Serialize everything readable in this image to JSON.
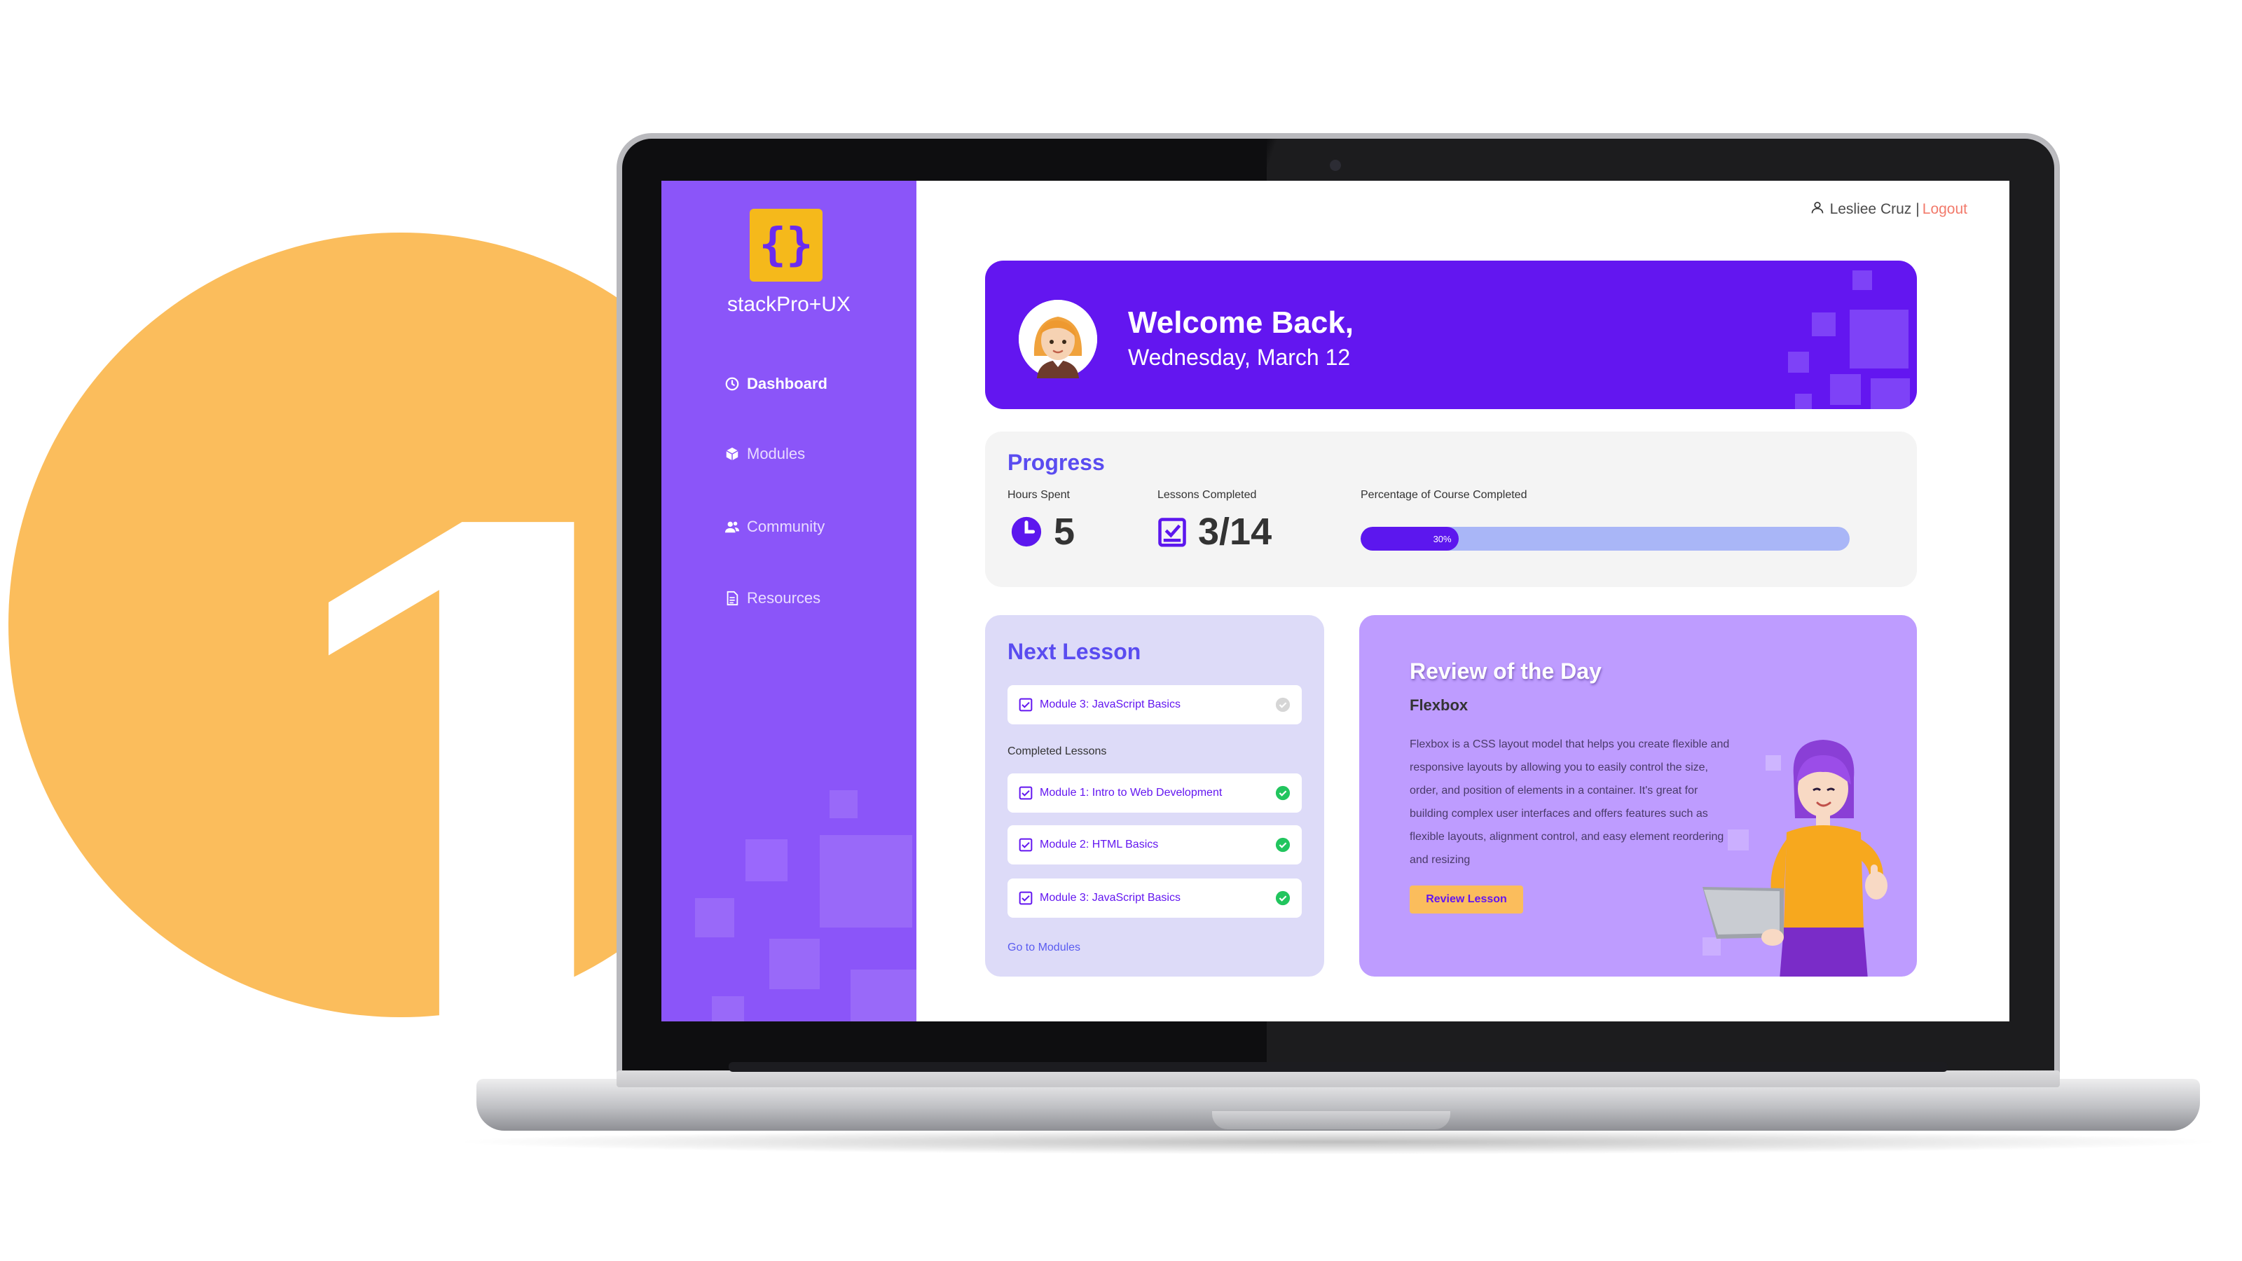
{
  "badge": {
    "numeral": "1"
  },
  "sidebar": {
    "brand": "stackPro+UX",
    "logo_glyph": "{}",
    "items": [
      {
        "label": "Dashboard",
        "icon": "clock-icon",
        "active": true
      },
      {
        "label": "Modules",
        "icon": "cube-icon",
        "active": false
      },
      {
        "label": "Community",
        "icon": "users-icon",
        "active": false
      },
      {
        "label": "Resources",
        "icon": "document-icon",
        "active": false
      }
    ]
  },
  "user": {
    "name": "Lesliee Cruz",
    "separator": "|",
    "logout": "Logout"
  },
  "welcome": {
    "title": "Welcome Back,",
    "date": "Wednesday, March 12"
  },
  "progress": {
    "title": "Progress",
    "hours_label": "Hours Spent",
    "hours_value": "5",
    "lessons_label": "Lessons Completed",
    "lessons_value": "3/14",
    "percent_label": "Percentage of Course Completed",
    "percent_text": "30%",
    "percent_fraction": 0.2
  },
  "next_lesson": {
    "title": "Next Lesson",
    "current": "Module 3: JavaScript Basics",
    "completed_label": "Completed Lessons",
    "completed": [
      "Module 1: Intro to Web Development",
      "Module 2: HTML Basics",
      "Module 3: JavaScript Basics"
    ],
    "link": "Go to Modules"
  },
  "review": {
    "title": "Review of the Day",
    "topic": "Flexbox",
    "body": "Flexbox is a CSS layout model that helps you create flexible and responsive layouts by allowing you to easily control the size, order, and position of elements in a container. It's great for building complex user interfaces and offers features such as flexible layouts, alignment control, and easy element reordering and resizing",
    "button": "Review Lesson"
  },
  "colors": {
    "badge": "#FBBD5C",
    "sidebar": "#8B55F9",
    "welcome": "#6316F0",
    "accent": "#5A4CF0",
    "check": "#22C55E",
    "review_card": "#BE9CFF",
    "logout": "#F27A6B"
  }
}
